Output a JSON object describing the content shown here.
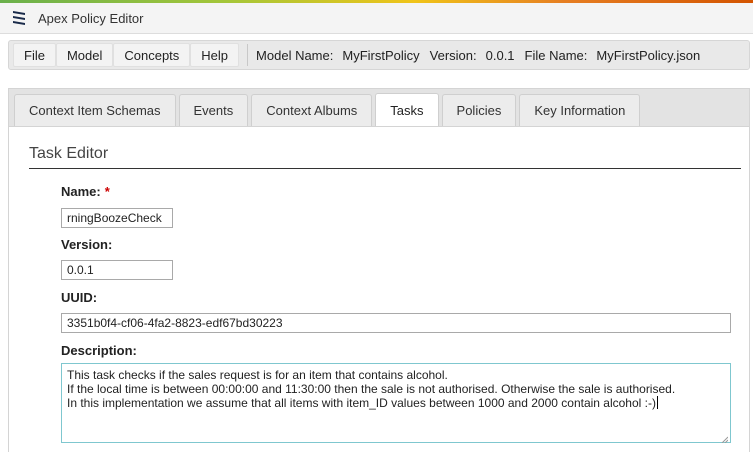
{
  "app": {
    "title": "Apex Policy Editor"
  },
  "menu": {
    "items": [
      "File",
      "Model",
      "Concepts",
      "Help"
    ]
  },
  "model_info": {
    "model_name_label": "Model Name:",
    "model_name": "MyFirstPolicy",
    "version_label": "Version:",
    "version": "0.0.1",
    "file_name_label": "File Name:",
    "file_name": "MyFirstPolicy.json"
  },
  "tabs": [
    {
      "label": "Context Item Schemas"
    },
    {
      "label": "Events"
    },
    {
      "label": "Context Albums"
    },
    {
      "label": "Tasks",
      "active": true
    },
    {
      "label": "Policies"
    },
    {
      "label": "Key Information"
    }
  ],
  "editor": {
    "title": "Task Editor",
    "name_label": "Name:",
    "required_mark": "*",
    "name_value": "rningBoozeCheck",
    "version_label": "Version:",
    "version_value": "0.0.1",
    "uuid_label": "UUID:",
    "uuid_value": "3351b0f4-cf06-4fa2-8823-edf67bd30223",
    "description_label": "Description:",
    "description_lines": [
      "This task checks if the sales request is for an item that contains alcohol.",
      "If the local time is between 00:00:00 and 11:30:00 then the sale is not authorised. Otherwise the sale is authorised.",
      "In this implementation we assume that all items with item_ID values between 1000 and 2000 contain alcohol :-)"
    ]
  },
  "colors": {
    "required": "#cc0000",
    "description_focus_border": "#7fc7cf",
    "title_rule": "#333333"
  },
  "icons": {
    "logo": "apex-logo-icon",
    "resize": "resize-grip-icon"
  }
}
